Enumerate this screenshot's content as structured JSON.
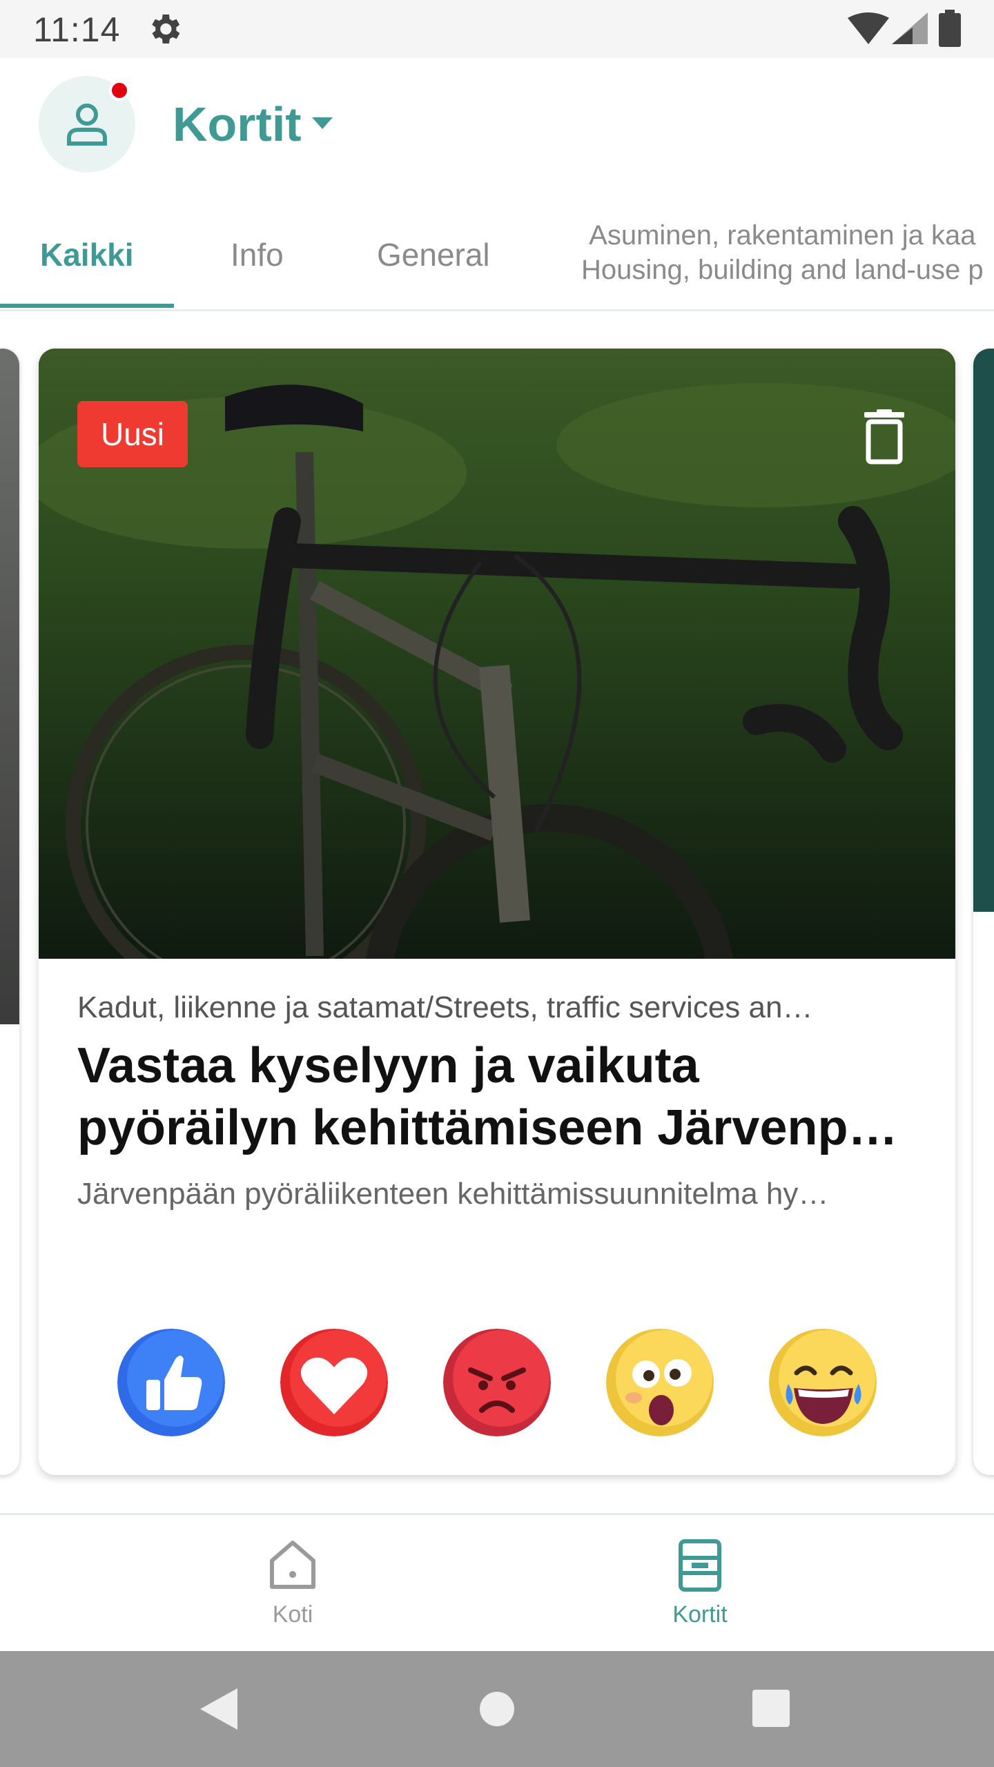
{
  "status_bar": {
    "time": "11:14"
  },
  "header": {
    "title": "Kortit"
  },
  "tabs": {
    "items": [
      {
        "label": "Kaikki",
        "active": true
      },
      {
        "label": "Info",
        "active": false
      },
      {
        "label": "General",
        "active": false
      }
    ],
    "partial_tab": {
      "line1": "Asuminen, rakentaminen ja kaa",
      "line2": "Housing, building and land-use p"
    }
  },
  "card": {
    "badge": "Uusi",
    "category": "Kadut, liikenne ja satamat/Streets, traffic services an…",
    "title_line1": "Vastaa kyselyyn ja vaikuta",
    "title_line2": "pyöräilyn kehittämiseen Järvenp…",
    "description": "Järvenpään pyöräliikenteen kehittämissuunnitelma hy…",
    "reactions": [
      "like-icon",
      "heart-icon",
      "angry-icon",
      "surprised-icon",
      "laughing-icon"
    ]
  },
  "bottom_nav": {
    "items": [
      {
        "label": "Koti",
        "icon": "home-icon",
        "active": false
      },
      {
        "label": "Kortit",
        "icon": "cards-icon",
        "active": true
      }
    ]
  },
  "colors": {
    "accent": "#3f9a95",
    "badge_red": "#ef3a32",
    "like_blue": "#2f6ae8",
    "heart_red": "#ed2f2f",
    "angry_red": "#e0303a",
    "emoji_yellow": "#f7d348"
  }
}
